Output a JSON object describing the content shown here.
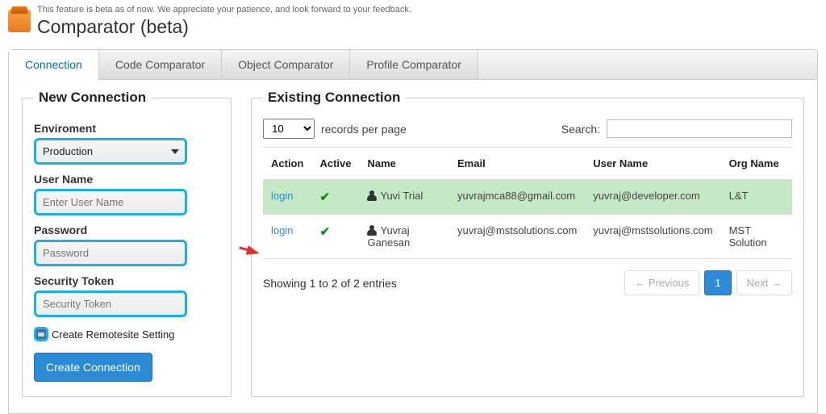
{
  "header": {
    "beta_note": "This feature is beta as of now. We appreciate your patience, and look forward to your feedback.",
    "title": "Comparator (beta)"
  },
  "tabs": {
    "connection": "Connection",
    "code": "Code Comparator",
    "object": "Object Comparator",
    "profile": "Profile Comparator"
  },
  "new_conn": {
    "legend": "New Connection",
    "env_label": "Enviroment",
    "env_value": "Production",
    "user_label": "User Name",
    "user_placeholder": "Enter User Name",
    "pass_label": "Password",
    "pass_placeholder": "Password",
    "token_label": "Security Token",
    "token_placeholder": "Security Token",
    "remote_label": "Create Remotesite Setting",
    "submit": "Create Connection"
  },
  "existing": {
    "legend": "Existing Connection",
    "per_page_value": "10",
    "per_page_text": "records per page",
    "search_label": "Search:",
    "headers": {
      "action": "Action",
      "active": "Active",
      "name": "Name",
      "email": "Email",
      "username": "User Name",
      "org": "Org Name"
    },
    "rows": [
      {
        "action": "login",
        "active": true,
        "name": "Yuvi Trial",
        "email": "yuvrajmca88@gmail.com",
        "username": "yuvraj@developer.com",
        "org": "L&T",
        "hl": true
      },
      {
        "action": "login",
        "active": true,
        "name": "Yuvraj Ganesan",
        "email": "yuvraj@mstsolutions.com",
        "username": "yuvraj@mstsolutions.com",
        "org": "MST Solution",
        "hl": false
      }
    ],
    "showing": "Showing 1 to 2 of 2 entries",
    "prev": "← Previous",
    "page": "1",
    "next": "Next →"
  }
}
